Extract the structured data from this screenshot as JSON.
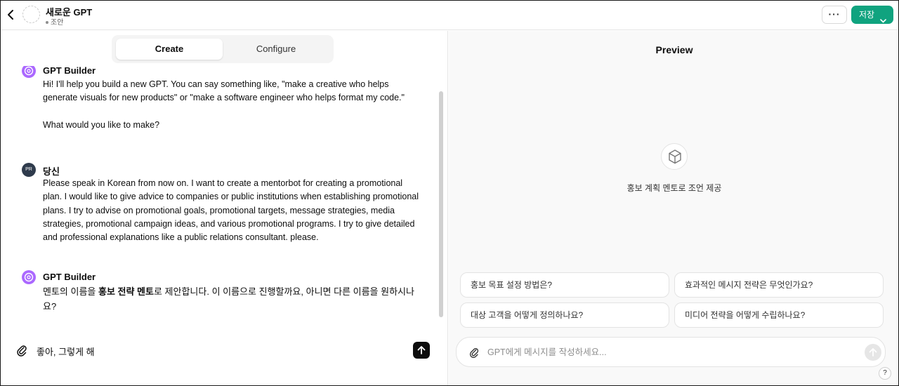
{
  "header": {
    "gpt_name": "새로운 GPT",
    "status": "조안",
    "more_label": "···",
    "save_label": "저장"
  },
  "tabs": [
    {
      "label": "Create",
      "active": true
    },
    {
      "label": "Configure",
      "active": false
    }
  ],
  "messages": [
    {
      "sender": "GPT Builder",
      "paragraphs": [
        "Hi! I'll help you build a new GPT. You can say something like, \"make a creative who helps generate visuals for new products\" or \"make a software engineer who helps format my code.\"",
        "What would you like to make?"
      ]
    },
    {
      "sender": "당신",
      "avatar_initials": "PR",
      "paragraphs": [
        "Please speak in Korean from now on. I want to create a mentorbot for creating a promotional plan. I would like to give advice to companies or public institutions when establishing promotional plans. I try to advise on promotional goals, promotional targets, message strategies, media strategies, promotional campaign ideas, and various promotional programs. I try to give detailed and professional explanations like a public relations consultant. please."
      ]
    },
    {
      "sender": "GPT Builder",
      "text_before": "멘토의 이름을 ",
      "text_bold": "홍보 전략 멘토",
      "text_after": "로 제안합니다. 이 이름으로 진행할까요, 아니면 다른 이름을 원하시나요?"
    }
  ],
  "composer": {
    "text": "좋아, 그렇게 해"
  },
  "preview": {
    "title": "Preview",
    "description": "홍보 계획 멘토로 조언 제공",
    "suggestions": [
      "홍보 목표 설정 방법은?",
      "효과적인 메시지 전략은 무엇인가요?",
      "대상 고객을 어떻게 정의하나요?",
      "미디어 전략을 어떻게 수립하나요?"
    ],
    "input_placeholder": "GPT에게 메시지를 작성하세요...",
    "help_label": "?"
  },
  "colors": {
    "accent": "#10a37f",
    "builder_avatar": "#ab68ff",
    "user_avatar": "#2f3b4c"
  },
  "icons": [
    "back-arrow-icon",
    "chevron-down-icon",
    "openai-logo-icon",
    "arrow-down-icon",
    "paperclip-icon",
    "arrow-up-icon",
    "cube-icon"
  ]
}
